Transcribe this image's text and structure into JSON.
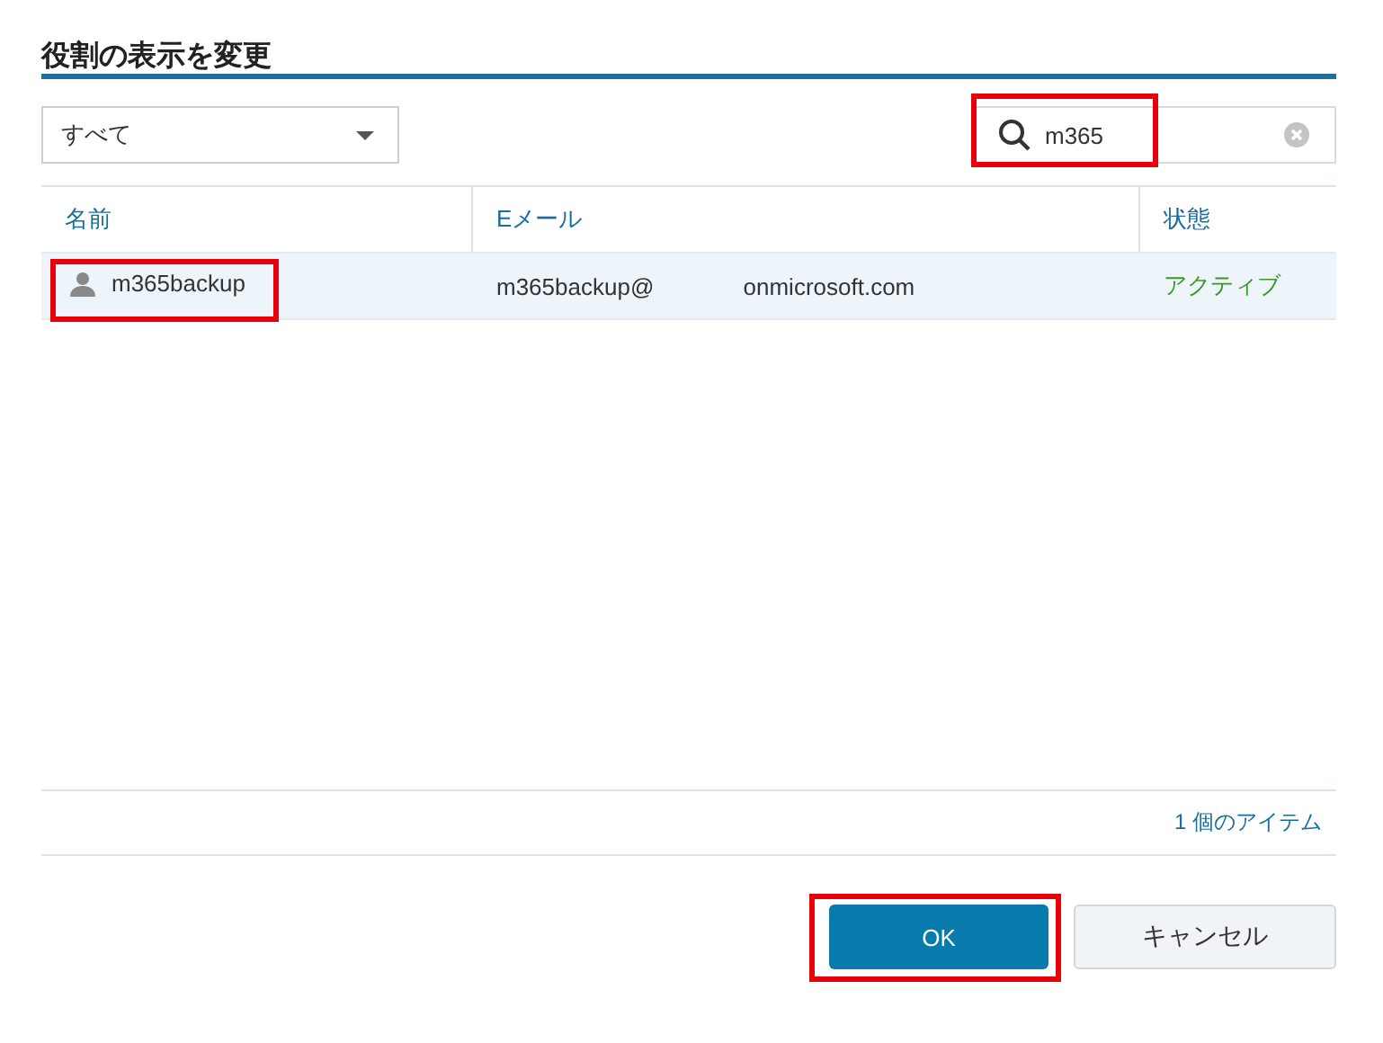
{
  "dialog": {
    "title": "役割の表示を変更"
  },
  "filter": {
    "value": "すべて"
  },
  "search": {
    "value": "m365",
    "highlighted": true
  },
  "table": {
    "columns": [
      "名前",
      "Eメール",
      "状態"
    ],
    "rows": [
      {
        "name": "m365backup",
        "email_user": "m365backup@",
        "email_domain": "onmicrosoft.com",
        "status": "アクティブ",
        "selected": true,
        "highlighted": true
      }
    ]
  },
  "item_count": "1 個のアイテム",
  "buttons": [
    {
      "label": "OK",
      "kind": "primary",
      "highlighted": true
    },
    {
      "label": "キャンセル",
      "kind": "secondary",
      "highlighted": false
    }
  ]
}
